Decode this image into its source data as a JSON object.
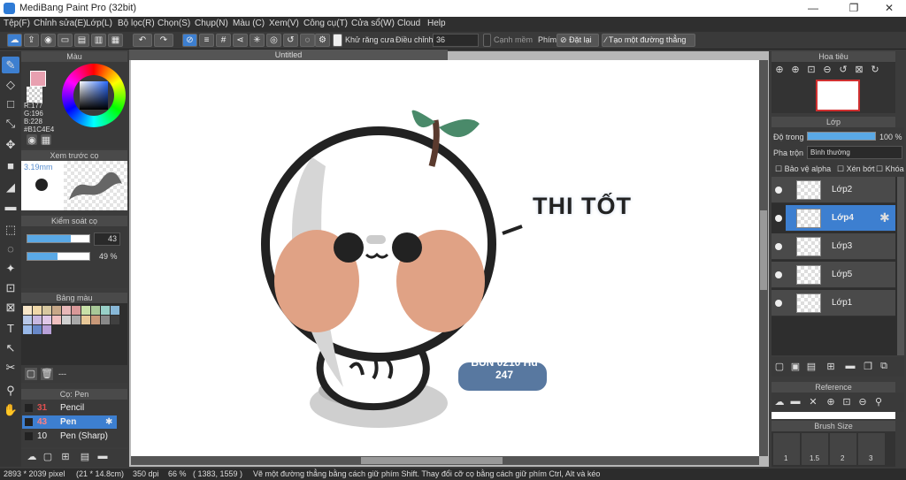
{
  "app": {
    "title": "MediBang Paint Pro (32bit)"
  },
  "menu": [
    "Tệp(F)",
    "Chỉnh sửa(E)",
    "Lớp(L)",
    "Bộ lọc(R)",
    "Chọn(S)",
    "Chụp(N)",
    "Màu (C)",
    "Xem(V)",
    "Công cụ(T)",
    "Cửa sổ(W)",
    "Cloud",
    "Help"
  ],
  "toolbar": {
    "antialias_label": "Khử răng cưa",
    "adjust_label": "Điều chỉnh",
    "adjust_value": "36",
    "edge_label": "Cạnh mềm",
    "key_label": "Phím",
    "reset_label": "Đặt lại",
    "line_label": "Tạo một đường thẳng"
  },
  "document": {
    "tab": "Untitled"
  },
  "color_panel": {
    "title": "Màu",
    "r": "R:177",
    "g": "G:196",
    "b": "B:228",
    "hex": "#B1C4E4",
    "primary": "#e8a0b0",
    "secondary": "#ffffff",
    "accent": "#3d7fd0"
  },
  "brush_preview": {
    "title": "Xem trước cọ",
    "size": "3.19mm"
  },
  "brush_control": {
    "title": "Kiểm soát cọ",
    "size_value": "43",
    "opacity_value": "49 %",
    "size_fraction": 0.43,
    "opacity_fraction": 0.49
  },
  "palette": {
    "title": "Bảng màu",
    "colors": [
      "#f8e6c8",
      "#f0d8a8",
      "#d8c8a0",
      "#c8a888",
      "#e8b8b8",
      "#d89898",
      "#c8e0a8",
      "#a8c898",
      "#98d0c8",
      "#88b8d8",
      "#b8c8e8",
      "#c8b8e0",
      "#e0c8e8",
      "#f0c0c0",
      "#d0d0d0",
      "#a8a8a8",
      "#e8c898",
      "#c89878",
      "#888888",
      "#404040",
      "#98b8e8",
      "#6888c8",
      "#b8a0d8"
    ],
    "extra": "---"
  },
  "brush_panel": {
    "title": "Cọ: Pen",
    "items": [
      {
        "num": "31",
        "name": "Pencil",
        "num_color": "#e05050"
      },
      {
        "num": "43",
        "name": "Pen",
        "num_color": "#ff7070"
      },
      {
        "num": "10",
        "name": "Pen (Sharp)",
        "num_color": "#eeeeee"
      }
    ]
  },
  "navigator": {
    "title": "Hoa tiêu"
  },
  "layer_panel": {
    "title": "Lớp",
    "opacity_label": "Độ trong",
    "opacity_value": "100 %",
    "blend_label": "Pha trộn",
    "blend_value": "Bình thường",
    "protect_alpha": "Bảo vệ alpha",
    "clip": "Xén bớt",
    "lock": "Khóa",
    "layers": [
      "Lớp2",
      "Lớp4",
      "Lớp3",
      "Lớp5",
      "Lớp1"
    ]
  },
  "reference": {
    "title": "Reference"
  },
  "brush_size": {
    "title": "Brush Size",
    "values": [
      "1",
      "1.5",
      "2",
      "3"
    ]
  },
  "artwork": {
    "caption": "THI TỐT",
    "signature": "BÚN 0210 Hd 247"
  },
  "status": {
    "pixels": "2893 * 2039 pixel",
    "cm": "(21 * 14.8cm)",
    "dpi": "350 dpi",
    "zoom": "66 %",
    "coords": "( 1383, 1559 )",
    "hint": "Vẽ một đường thẳng bằng cách giữ phím Shift. Thay đổi cỡ cọ bằng cách giữ phím Ctrl, Alt và kéo"
  }
}
